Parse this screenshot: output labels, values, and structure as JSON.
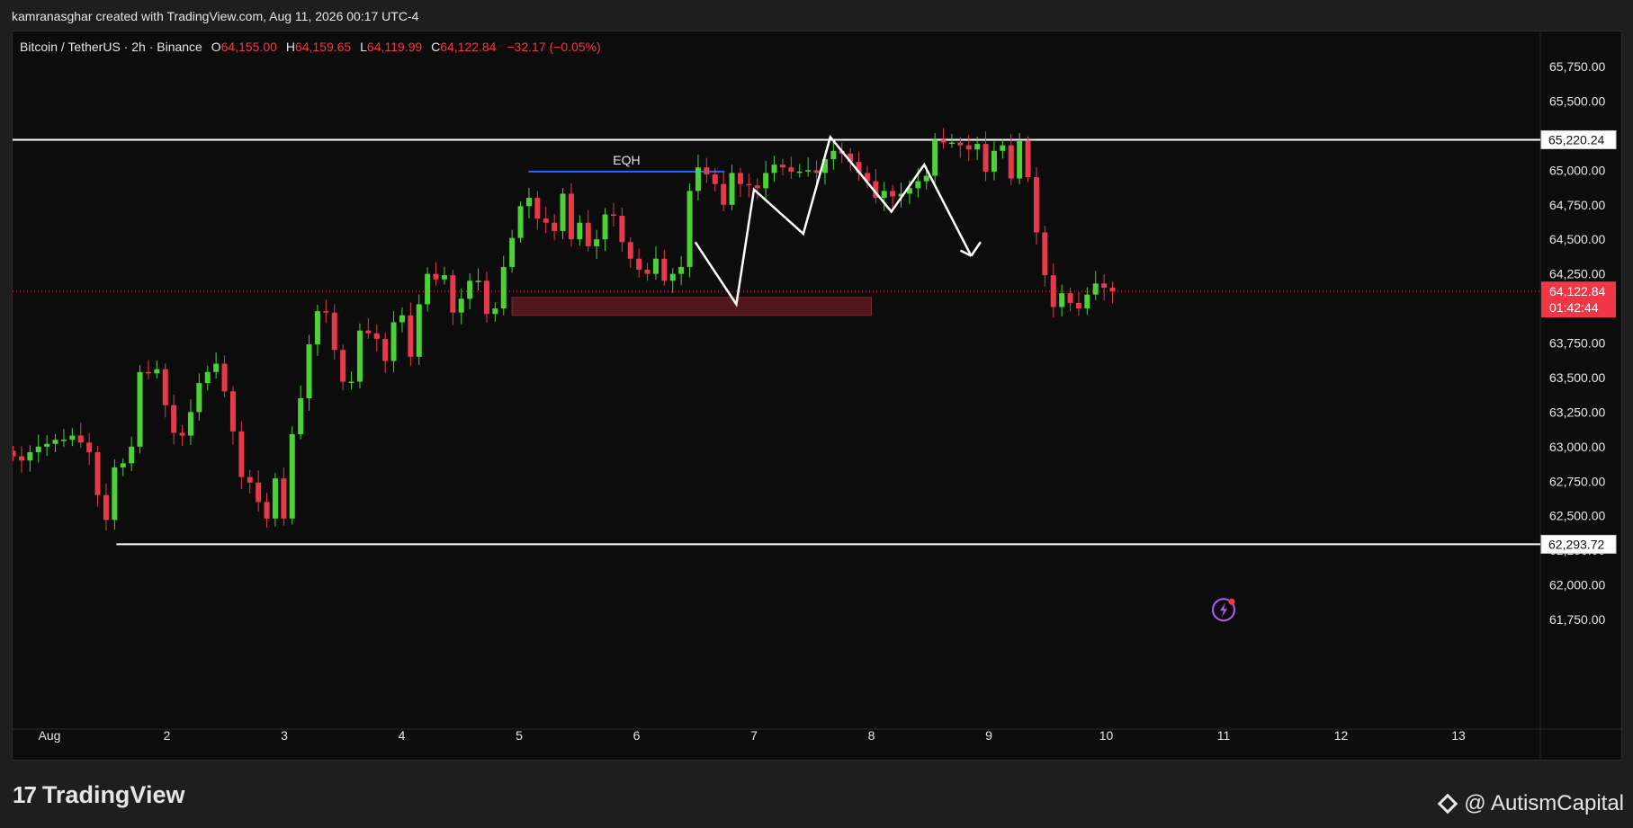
{
  "header": {
    "credit": "kamranasghar created with TradingView.com, Aug 11, 2026 00:17 UTC-4"
  },
  "legend": {
    "symbol": "Bitcoin / TetherUS · 2h · Binance",
    "o_label": "O",
    "o_value": "64,155.00",
    "h_label": "H",
    "h_value": "64,159.65",
    "l_label": "L",
    "l_value": "64,119.99",
    "c_label": "C",
    "c_value": "64,122.84",
    "change": "−32.17 (−0.05%)"
  },
  "footer": {
    "logo_text": "TradingView",
    "logo_mark": "17",
    "watermark": "@ AutismCapital"
  },
  "colors": {
    "up": "#4cd137",
    "down": "#e6394a",
    "background": "#0c0c0c",
    "zone": "#5c1a22",
    "eqh_line": "#2962ff",
    "current_price_box": "#f23645"
  },
  "chart_data": {
    "type": "candlestick",
    "ylim": [
      61600,
      65950
    ],
    "y_ticks": [
      "65,750.00",
      "65,500.00",
      "65,250.00",
      "65,000.00",
      "64,750.00",
      "64,500.00",
      "64,250.00",
      "64,000.00",
      "63,750.00",
      "63,500.00",
      "63,250.00",
      "63,000.00",
      "62,750.00",
      "62,500.00",
      "62,250.00",
      "62,000.00",
      "61,750.00"
    ],
    "y_tick_values": [
      65750,
      65500,
      65250,
      65000,
      64750,
      64500,
      64250,
      64000,
      63750,
      63500,
      63250,
      63000,
      62750,
      62500,
      62250,
      62000,
      61750
    ],
    "x_ticks": [
      "Aug",
      "2",
      "3",
      "4",
      "5",
      "6",
      "7",
      "8",
      "9",
      "10",
      "11",
      "12",
      "13"
    ],
    "x_tick_values": [
      0,
      1,
      2,
      3,
      4,
      5,
      6,
      7,
      8,
      9,
      10,
      11,
      12
    ],
    "candles_close": [
      62930,
      62900,
      62960,
      63000,
      63020,
      63050,
      63050,
      63080,
      63030,
      62960,
      62650,
      62470,
      62850,
      62880,
      63000,
      63540,
      63530,
      63560,
      63300,
      63100,
      63080,
      63250,
      63460,
      63540,
      63600,
      63400,
      63110,
      62780,
      62740,
      62600,
      62480,
      62770,
      62480,
      63090,
      63350,
      63740,
      63980,
      63970,
      63700,
      63470,
      63470,
      63840,
      63820,
      63780,
      63620,
      63900,
      63950,
      63650,
      64030,
      64250,
      64210,
      64240,
      63970,
      64070,
      64200,
      64200,
      63960,
      64000,
      64300,
      64510,
      64740,
      64800,
      64650,
      64620,
      64560,
      64830,
      64500,
      64620,
      64450,
      64500,
      64680,
      64670,
      64480,
      64360,
      64280,
      64250,
      64360,
      64200,
      64250,
      64300,
      64850,
      65020,
      64970,
      64900,
      64750,
      64980,
      64900,
      64890,
      64870,
      64980,
      65040,
      65020,
      64990,
      64990,
      65000,
      64980,
      65080,
      65140,
      65120,
      65060,
      64980,
      64920,
      64800,
      64850,
      64810,
      64830,
      64870,
      64920,
      64960,
      65220,
      65200,
      65200,
      65180,
      65150,
      65190,
      64990,
      65140,
      65180,
      64940,
      65210,
      64950,
      64550,
      64240,
      64010,
      64110,
      64040,
      64000,
      64100,
      64180,
      64150,
      64123
    ],
    "current_price": {
      "label": "64,122.84",
      "value": 64122.84,
      "countdown": "01:42:44"
    },
    "price_boxes": [
      {
        "label": "65,220.24",
        "value": 65220.24
      },
      {
        "label": "62,293.72",
        "value": 62293.72
      }
    ],
    "annotations": {
      "eqh_label": "EQH",
      "eqh_value": 64990,
      "zone_top": 64080,
      "zone_bottom": 63950
    },
    "zigzag_projection": [
      {
        "day": 5.5,
        "price": 64480
      },
      {
        "day": 5.85,
        "price": 64030
      },
      {
        "day": 6.0,
        "price": 64860
      },
      {
        "day": 6.42,
        "price": 64540
      },
      {
        "day": 6.65,
        "price": 65240
      },
      {
        "day": 7.17,
        "price": 64700
      },
      {
        "day": 7.45,
        "price": 65040
      },
      {
        "day": 7.85,
        "price": 64380
      }
    ],
    "projection_arrow_end": {
      "day": 7.93,
      "price": 64480
    }
  }
}
